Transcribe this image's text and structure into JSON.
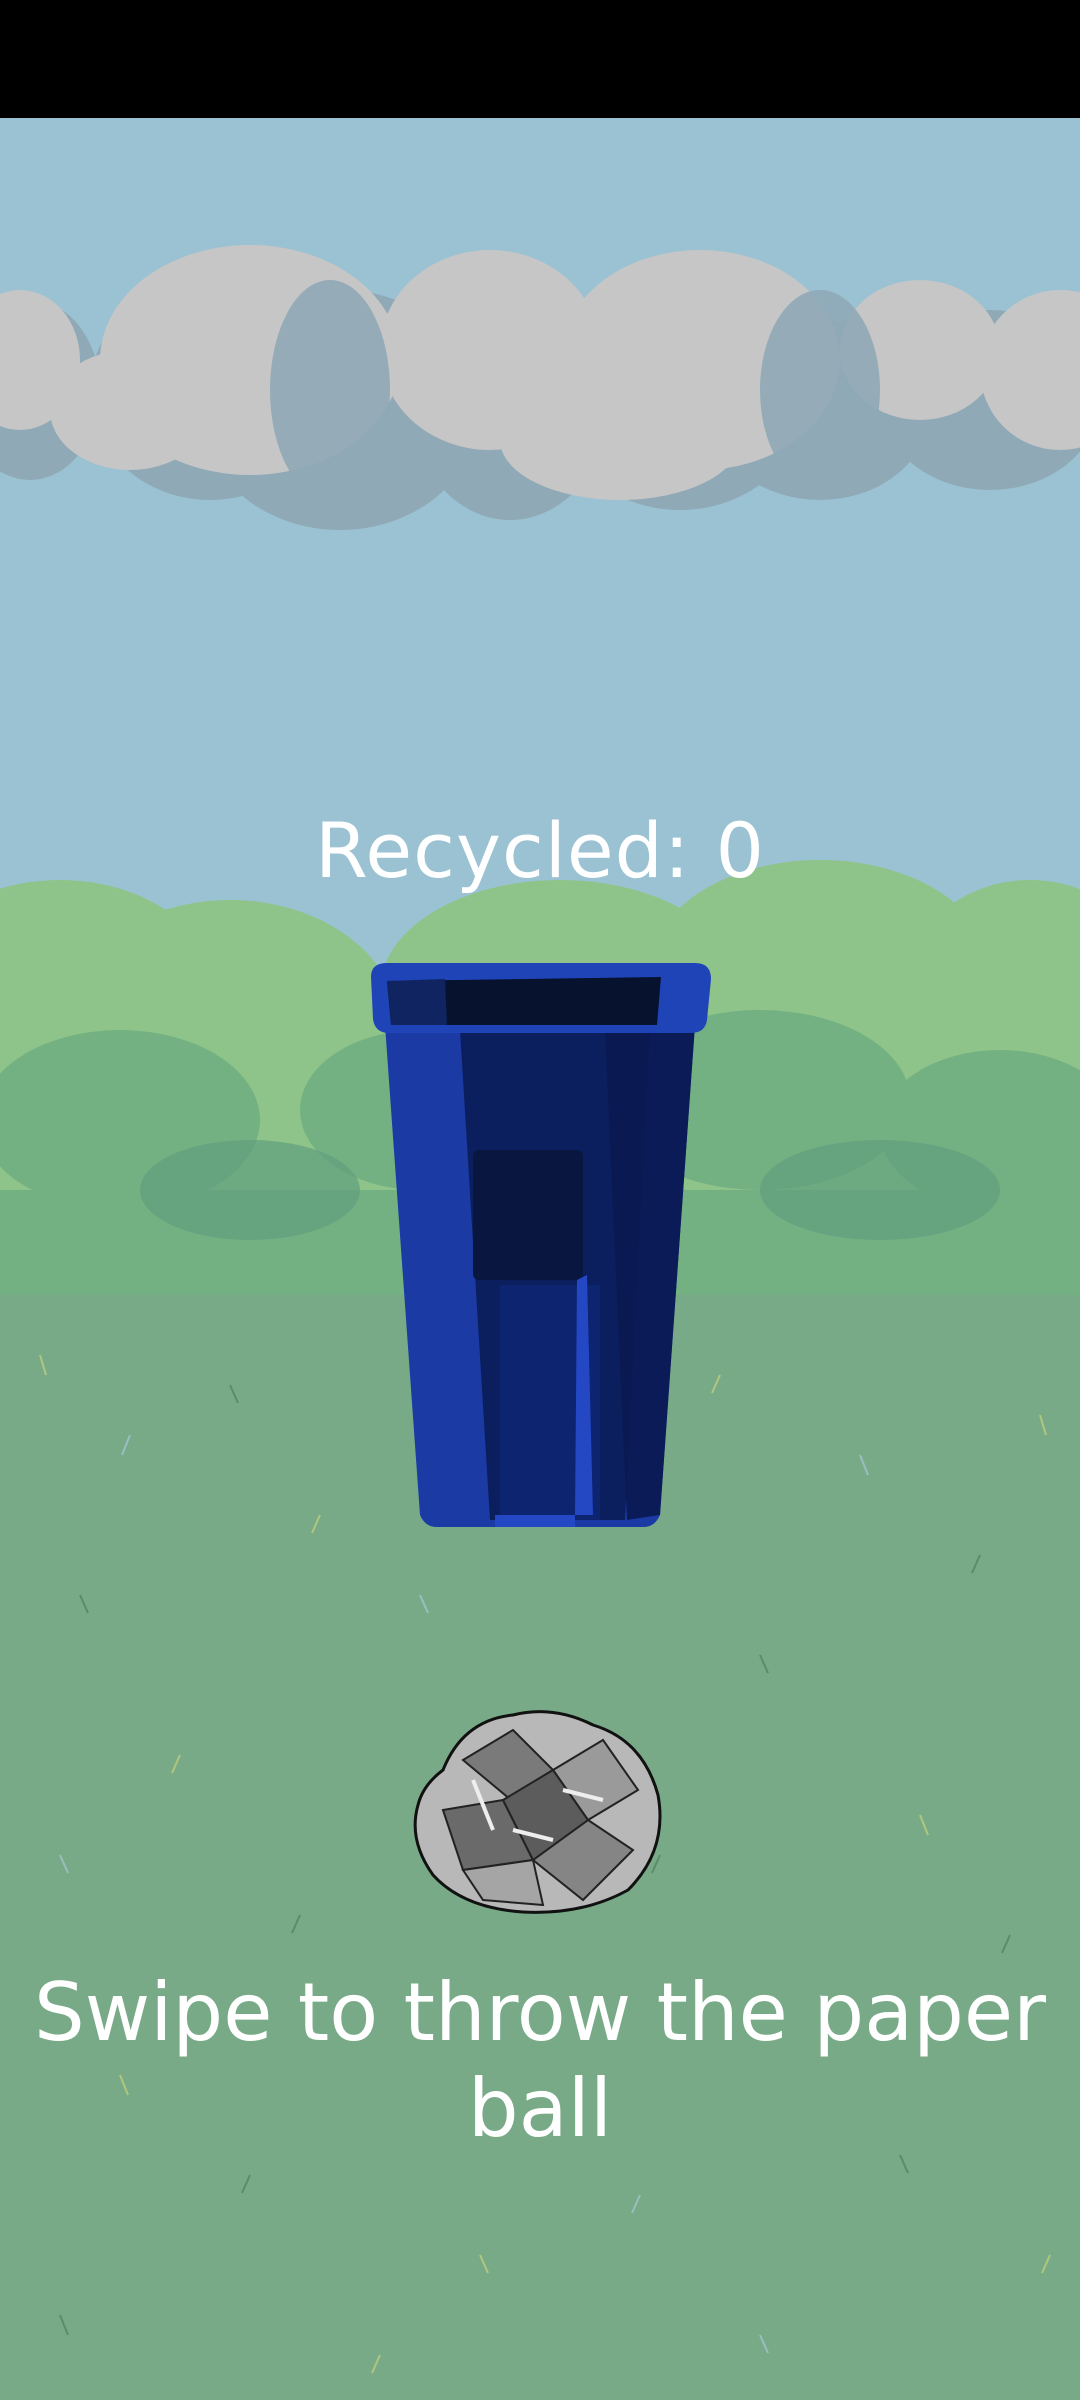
{
  "hud": {
    "score_text": "Recycled: 0"
  },
  "instructions": {
    "text": "Swipe to throw the paper ball"
  },
  "colors": {
    "sky": "#9bc2d3",
    "cloud": "#c6c6c6",
    "bush": "#8ec489",
    "lawn": "#78aa88",
    "bin": "#1b3aa4",
    "text": "#ffffff"
  },
  "icons": {
    "bin": "recycling-bin-icon",
    "ball": "paper-ball-icon"
  }
}
